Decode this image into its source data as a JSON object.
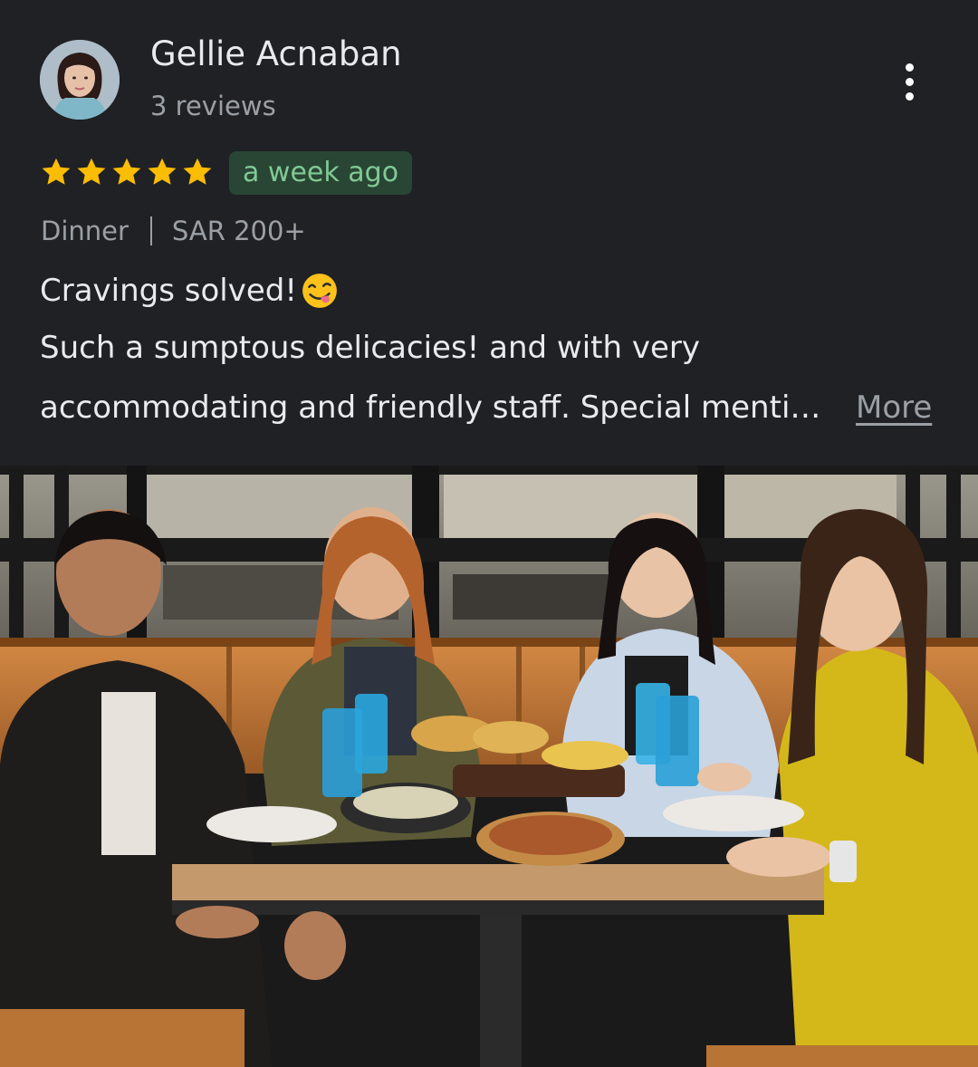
{
  "reviewer": {
    "name": "Gellie Acnaban",
    "review_count": "3 reviews"
  },
  "rating": {
    "stars": 5,
    "star_color": "#fbbc04",
    "time_ago": "a week ago"
  },
  "meta": {
    "meal_type": "Dinner",
    "price_range": "SAR 200+"
  },
  "review": {
    "title": "Cravings solved!",
    "line1": "Such a sumptous delicacies! and with very",
    "line2": "accommodating and friendly staff. Special menti…",
    "more_label": "More"
  },
  "icons": {
    "menu": "more-vert-icon",
    "emoji": "face-savoring-food-icon"
  },
  "colors": {
    "background": "#202124",
    "badge_bg": "#294634",
    "badge_text": "#81c995"
  }
}
